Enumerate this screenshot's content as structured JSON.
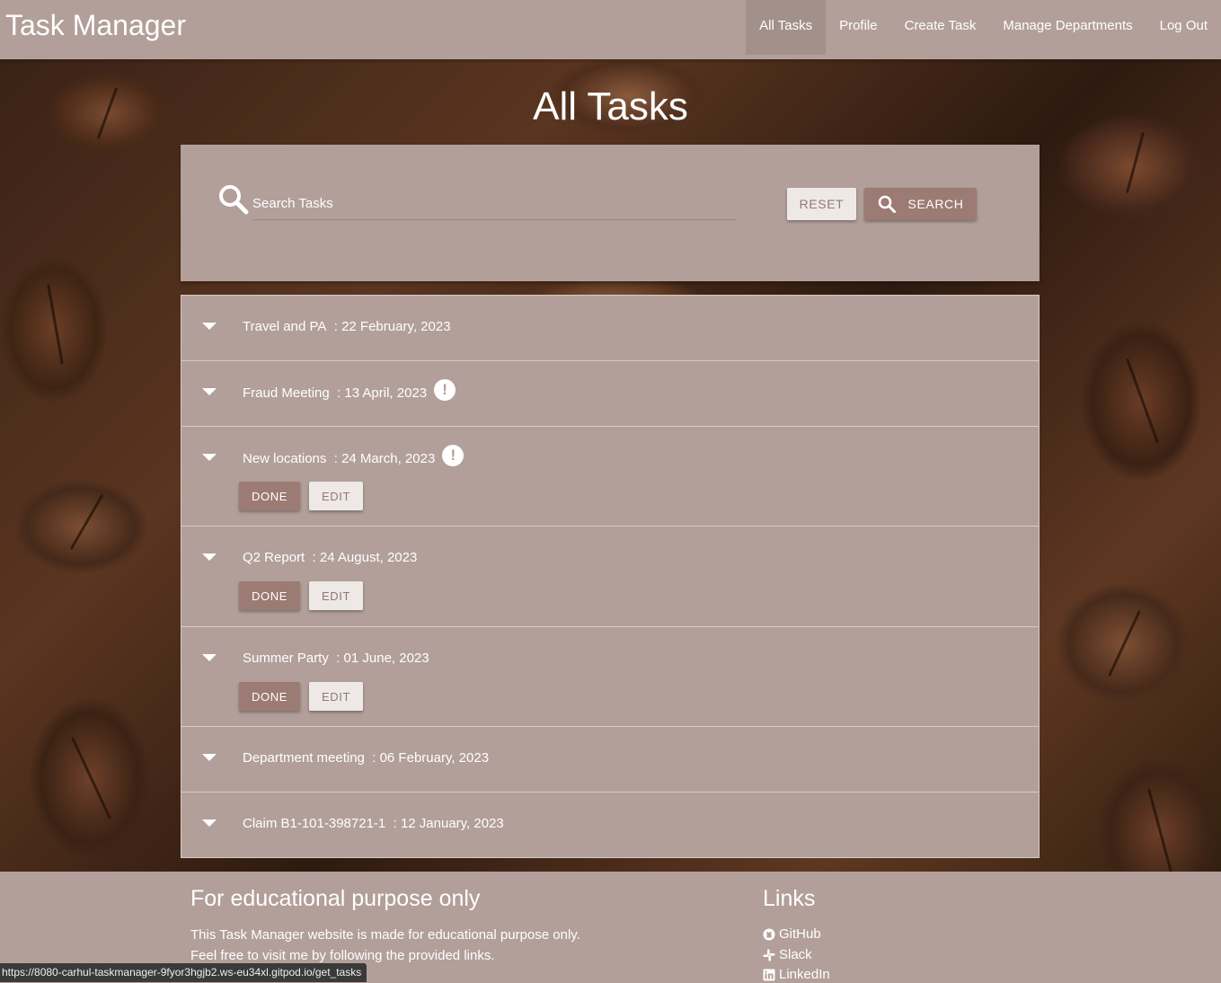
{
  "navbar": {
    "brand": "Task Manager",
    "links": [
      {
        "label": "All Tasks",
        "active": true
      },
      {
        "label": "Profile"
      },
      {
        "label": "Create Task"
      },
      {
        "label": "Manage Departments"
      },
      {
        "label": "Log Out"
      }
    ]
  },
  "page": {
    "title": "All Tasks"
  },
  "search": {
    "placeholder": "Search Tasks",
    "reset_label": "RESET",
    "search_label": "SEARCH",
    "icon": "search-icon"
  },
  "tasks": [
    {
      "name": "Travel and PA",
      "date": ": 22 February, 2023",
      "urgent": false,
      "actions": false
    },
    {
      "name": "Fraud Meeting",
      "date": ": 13 April, 2023",
      "urgent": true,
      "actions": false
    },
    {
      "name": "New locations",
      "date": ": 24 March, 2023",
      "urgent": true,
      "actions": true
    },
    {
      "name": "Q2 Report",
      "date": ": 24 August, 2023",
      "urgent": false,
      "actions": true
    },
    {
      "name": "Summer Party",
      "date": ": 01 June, 2023",
      "urgent": false,
      "actions": true
    },
    {
      "name": "Department meeting",
      "date": ": 06 February, 2023",
      "urgent": false,
      "actions": false
    },
    {
      "name": "Claim B1-101-398721-1",
      "date": ": 12 January, 2023",
      "urgent": false,
      "actions": false
    }
  ],
  "task_buttons": {
    "done": "DONE",
    "edit": "EDIT"
  },
  "urgent_glyph": "!",
  "footer": {
    "left_title": "For educational purpose only",
    "left_line1": "This Task Manager website is made for educational purpose only.",
    "left_line2": "Feel free to visit me by following the provided links.",
    "right_title": "Links",
    "links": [
      {
        "label": "GitHub",
        "icon": "github-icon"
      },
      {
        "label": "Slack",
        "icon": "slack-icon"
      },
      {
        "label": "LinkedIn",
        "icon": "linkedin-icon"
      }
    ]
  },
  "statusbar": {
    "url": "https://8080-carhul-taskmanager-9fyor3hgjb2.ws-eu34xl.gitpod.io/get_tasks"
  },
  "colors": {
    "panel": "#b29f99",
    "nav_active": "#a2918b",
    "button_dark": "#9b7b74",
    "button_light": "#efe9e6"
  }
}
